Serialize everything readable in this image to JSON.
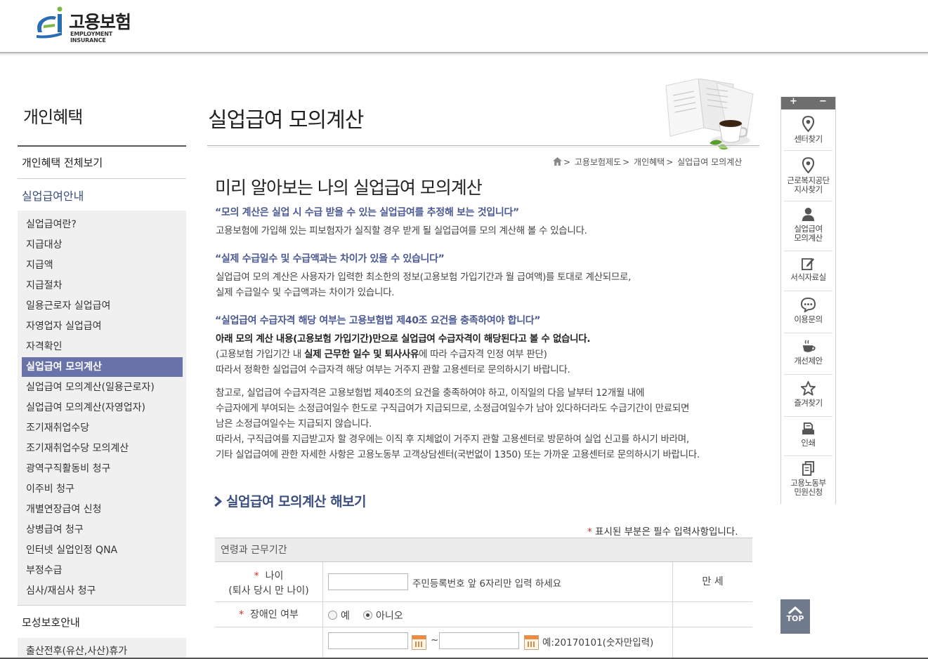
{
  "header": {
    "logo_ko": "고용보험",
    "logo_en": "EMPLOYMENT INSURANCE"
  },
  "sidebar": {
    "title": "개인혜택",
    "view_all": "개인혜택 전체보기",
    "section1": "실업급여안내",
    "items": [
      {
        "label": "실업급여란?",
        "active": false
      },
      {
        "label": "지급대상",
        "active": false
      },
      {
        "label": "지급액",
        "active": false
      },
      {
        "label": "지급절차",
        "active": false
      },
      {
        "label": "일용근로자 실업급여",
        "active": false
      },
      {
        "label": "자영업자 실업급여",
        "active": false
      },
      {
        "label": "자격확인",
        "active": false
      },
      {
        "label": "실업급여 모의계산",
        "active": true
      },
      {
        "label": "실업급여 모의계산(일용근로자)",
        "active": false
      },
      {
        "label": "실업급여 모의계산(자영업자)",
        "active": false
      },
      {
        "label": "조기재취업수당",
        "active": false
      },
      {
        "label": "조기재취업수당 모의계산",
        "active": false
      },
      {
        "label": "광역구직활동비 청구",
        "active": false
      },
      {
        "label": "이주비 청구",
        "active": false
      },
      {
        "label": "개별연장급여 신청",
        "active": false
      },
      {
        "label": "상병급여 청구",
        "active": false
      },
      {
        "label": "인터넷 실업인정 QNA",
        "active": false
      },
      {
        "label": "부정수급",
        "active": false
      },
      {
        "label": "심사/재심사 청구",
        "active": false
      }
    ],
    "section2": "모성보호안내",
    "section2_first": "출산전후(유산,사산)휴가"
  },
  "main": {
    "page_title": "실업급여 모의계산",
    "breadcrumb": [
      "고용보험제도",
      "개인혜택",
      "실업급여 모의계산"
    ],
    "sub_title": "미리 알아보는 나의 실업급여 모의계산",
    "quote1": "“모의 계산은 실업 시 수급 받을 수 있는 실업급여를 추정해 보는 것입니다”",
    "text1": "고용보험에 가입해 있는 피보험자가 실직할 경우 받게 될 실업급여를 모의 계산해 볼 수 있습니다.",
    "quote2": "“실제 수급일수 및 수급액과는 차이가 있을 수 있습니다”",
    "text2a": "실업급여 모의 계산은 사용자가 입력한 최소한의 정보(고용보험 가입기간과 월 급여액)를 토대로 계산되므로,",
    "text2b": "실제 수급일수 및 수급액과는 차이가 있습니다.",
    "quote3": "“실업급여 수급자격 해당 여부는 고용보험법 제40조 요건을 충족하여야 합니다”",
    "text3a": "아래 모의 계산 내용(고용보험 가입기간)만으로 실업급여 수급자격이 해당된다고 볼 수 없습니다.",
    "text3b_pre": "(고용보험 가입기간 내 ",
    "text3b_bold": "실제 근무한 일수 및 퇴사사유",
    "text3b_post": "에 따라 수급자격 인정 여부 판단)",
    "text3c": "따라서 정확한 실업급여 수급자격 해당 여부는 거주지 관할 고용센터로 문의하시기 바랍니다.",
    "text4a": "참고로, 실업급여 수급자격은 고용보험법 제40조의 요건을 충족하여야 하고, 이직일의 다음 날부터 12개월 내에",
    "text4b": "수급자에게 부여되는 소정급여일수 한도로 구직급여가 지급되므로, 소정급여일수가 남아 있다하더라도 수급기간이 만료되면",
    "text4c": "남은 소정급여일수는 지급되지 않습니다.",
    "text4d": "따라서, 구직급여를 지급받고자 할 경우에는 이직 후 지체없이 거주지 관할 고용센터로 방문하여 실업 신고를 하시기 바라며,",
    "text4e": "기타 실업급여에 관한 자세한 사항은 고용노동부 고객상담센터(국번없이 1350) 또는 가까운 고용센터로 문의하시기 바랍니다.",
    "calc_heading": "실업급여 모의계산 해보기",
    "req_note": "표시된 부분은 필수 입력사항입니다.",
    "form": {
      "section": "연령과 근무기간",
      "age_label1": "나이",
      "age_label2": "(퇴사 당시 만 나이)",
      "age_value": "",
      "age_hint": "주민등록번호 앞 6자리만 입력 하세요",
      "age_unit": "만 세",
      "disabled_label": "장애인 여부",
      "disabled_yes": "예",
      "disabled_no": "아니오",
      "disabled_selected": "아니오",
      "date_from": "",
      "date_to": "",
      "date_sep": "~",
      "date_hint": "예:20170101(숫자만입력)"
    }
  },
  "quick_menu": {
    "plus": "+",
    "minus": "−",
    "items": [
      {
        "label1": "센터찾기",
        "label2": ""
      },
      {
        "label1": "근로복지공단",
        "label2": "지사찾기"
      },
      {
        "label1": "실업급여",
        "label2": "모의계산"
      },
      {
        "label1": "서식자료실",
        "label2": ""
      },
      {
        "label1": "이용문의",
        "label2": ""
      },
      {
        "label1": "개선제안",
        "label2": ""
      },
      {
        "label1": "즐겨찾기",
        "label2": ""
      },
      {
        "label1": "인쇄",
        "label2": ""
      },
      {
        "label1": "고용노동부",
        "label2": "민원신청"
      }
    ],
    "top_label": "TOP"
  },
  "colors": {
    "accent": "#6973aa",
    "heading": "#3b4e80",
    "required": "#d62a2a"
  }
}
